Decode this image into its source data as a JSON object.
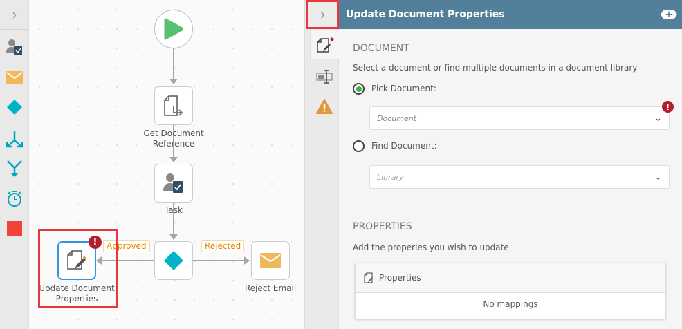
{
  "palette": {
    "items": [
      "task",
      "email",
      "decision",
      "parallel",
      "merge",
      "timer",
      "stop"
    ]
  },
  "canvas": {
    "nodes": {
      "get_doc": [
        "Get Document",
        "Reference"
      ],
      "task": "Task",
      "update_doc": [
        "Update Document",
        "Properties"
      ],
      "reject_email": "Reject Email"
    },
    "edges": {
      "approved": "Approved",
      "rejected": "Rejected"
    }
  },
  "panel": {
    "title": "Update Document Properties",
    "document": {
      "heading": "DOCUMENT",
      "description": "Select a document or find multiple documents in a document library",
      "pick_label": "Pick Document:",
      "pick_placeholder": "Document",
      "find_label": "Find Document:",
      "find_placeholder": "Library",
      "selected": "pick"
    },
    "properties": {
      "heading": "PROPERTIES",
      "description": "Add the properies you wish to update",
      "card_title": "Properties",
      "empty": "No mappings"
    }
  },
  "colors": {
    "header": "#527f99",
    "accent": "#00b3c8",
    "error": "#b01e2f",
    "warning": "#e09a3e"
  }
}
